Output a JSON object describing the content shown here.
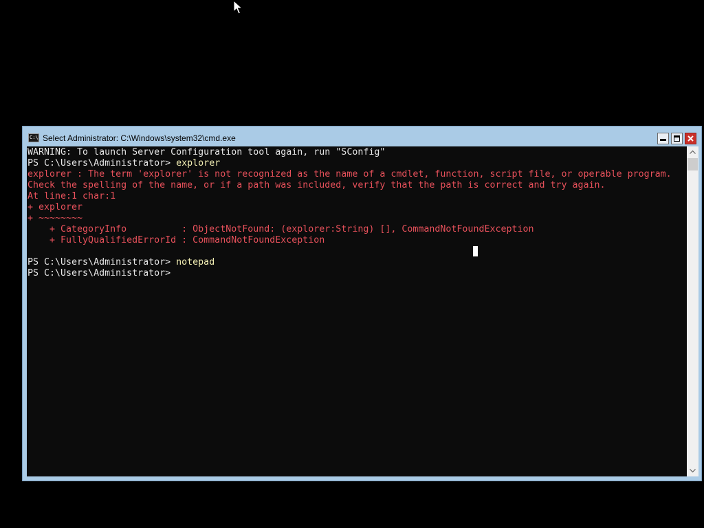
{
  "window": {
    "title": "Select Administrator: C:\\Windows\\system32\\cmd.exe",
    "icon": "cmd-console-icon",
    "icon_text": "C:\\",
    "controls": [
      "minimize-icon",
      "maximize-icon",
      "close-icon"
    ]
  },
  "console": {
    "lines": [
      {
        "text": "WARNING: To launch Server Configuration tool again, run \"SConfig\"",
        "style": "normal"
      },
      {
        "text": "PS C:\\Users\\Administrator> ",
        "style": "normal",
        "cmd": "explorer"
      },
      {
        "text": "explorer : The term 'explorer' is not recognized as the name of a cmdlet, function, script file, or operable program.",
        "style": "error"
      },
      {
        "text": "Check the spelling of the name, or if a path was included, verify that the path is correct and try again.",
        "style": "error"
      },
      {
        "text": "At line:1 char:1",
        "style": "error"
      },
      {
        "text": "+ explorer",
        "style": "error"
      },
      {
        "text": "+ ~~~~~~~~",
        "style": "error"
      },
      {
        "text": "    + CategoryInfo          : ObjectNotFound: (explorer:String) [], CommandNotFoundException",
        "style": "error"
      },
      {
        "text": "    + FullyQualifiedErrorId : CommandNotFoundException",
        "style": "error"
      },
      {
        "text": "",
        "style": "normal"
      },
      {
        "text": "PS C:\\Users\\Administrator> ",
        "style": "normal",
        "cmd": "notepad"
      },
      {
        "text": "PS C:\\Users\\Administrator> ",
        "style": "normal"
      }
    ]
  },
  "colors": {
    "background": "#0c0c0c",
    "text": "#e6e6e6",
    "error": "#e8515b",
    "command": "#f4f0b5",
    "window_frame": "#aacbe6"
  },
  "scrollbar": {
    "up_icon": "chevron-up-icon",
    "down_icon": "chevron-down-icon"
  }
}
